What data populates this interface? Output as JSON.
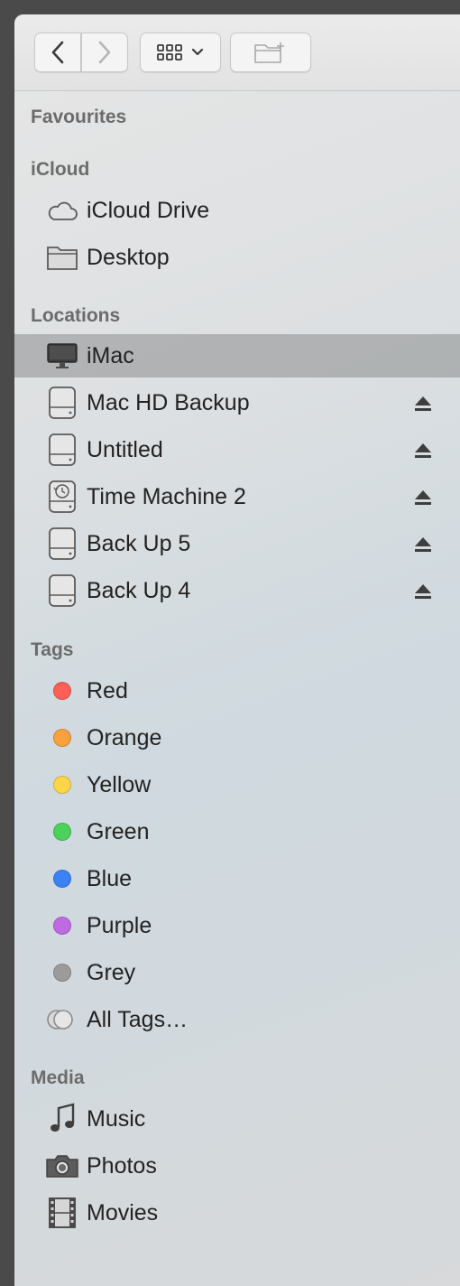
{
  "toolbar": {
    "back_icon": "chevron-left-icon",
    "forward_icon": "chevron-right-icon",
    "view_icon": "icon-grid-icon",
    "new_folder_icon": "new-folder-icon"
  },
  "sidebar": {
    "favourites": {
      "header": "Favourites"
    },
    "icloud": {
      "header": "iCloud",
      "items": [
        {
          "label": "iCloud Drive",
          "icon": "cloud-icon"
        },
        {
          "label": "Desktop",
          "icon": "folder-icon"
        }
      ]
    },
    "locations": {
      "header": "Locations",
      "items": [
        {
          "label": "iMac",
          "icon": "imac-icon",
          "selected": true
        },
        {
          "label": "Mac HD Backup",
          "icon": "drive-icon",
          "eject": true
        },
        {
          "label": "Untitled",
          "icon": "drive-icon",
          "eject": true
        },
        {
          "label": "Time Machine 2",
          "icon": "time-machine-drive-icon",
          "eject": true
        },
        {
          "label": "Back Up 5",
          "icon": "drive-icon",
          "eject": true
        },
        {
          "label": "Back Up 4",
          "icon": "drive-icon",
          "eject": true
        }
      ]
    },
    "tags": {
      "header": "Tags",
      "items": [
        {
          "label": "Red",
          "color": "#fe5f57"
        },
        {
          "label": "Orange",
          "color": "#f9a03f"
        },
        {
          "label": "Yellow",
          "color": "#fcd549"
        },
        {
          "label": "Green",
          "color": "#4cd25b"
        },
        {
          "label": "Blue",
          "color": "#3b82f6"
        },
        {
          "label": "Purple",
          "color": "#bf6ae3"
        },
        {
          "label": "Grey",
          "color": "#9b9b9b"
        },
        {
          "label": "All Tags…",
          "icon": "all-tags-icon"
        }
      ]
    },
    "media": {
      "header": "Media",
      "items": [
        {
          "label": "Music",
          "icon": "music-note-icon"
        },
        {
          "label": "Photos",
          "icon": "camera-icon"
        },
        {
          "label": "Movies",
          "icon": "film-icon"
        }
      ]
    }
  }
}
